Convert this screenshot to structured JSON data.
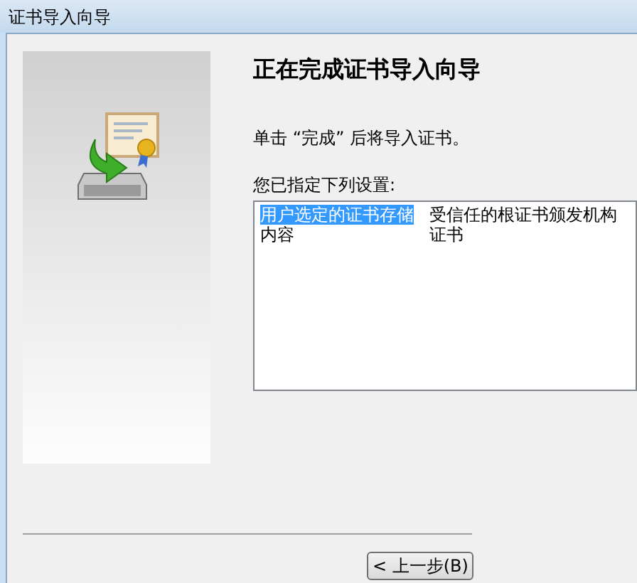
{
  "window": {
    "title": "证书导入向导"
  },
  "heading": "正在完成证书导入向导",
  "instruction": "单击 “完成” 后将导入证书。",
  "settings_label": "您已指定下列设置:",
  "settings": [
    {
      "name": "用户选定的证书存储",
      "value": "受信任的根证书颁发机构",
      "selected": true
    },
    {
      "name": "内容",
      "value": "证书",
      "selected": false
    }
  ],
  "buttons": [
    "< 上一步(B)"
  ]
}
